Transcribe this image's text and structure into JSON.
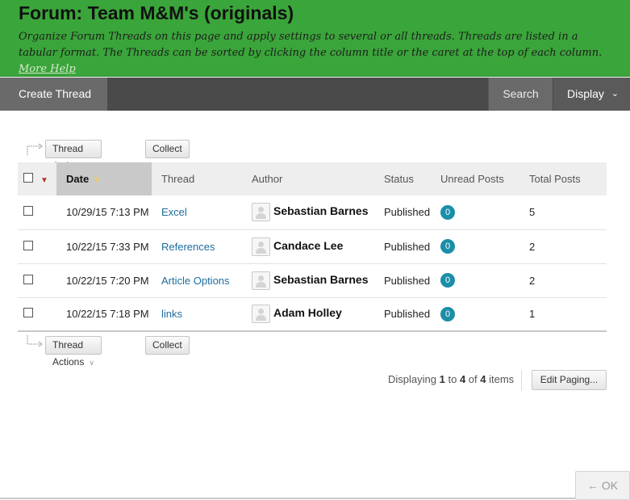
{
  "header": {
    "title": "Forum: Team M&M's (originals)",
    "description": "Organize Forum Threads on this page and apply settings to several or all threads. Threads are listed in a tabular format. The Threads can be sorted by clicking the column title or the caret at the top of each column.",
    "more_help": "More Help",
    "bg_color": "#3aa53a"
  },
  "toolbar": {
    "create_thread": "Create Thread",
    "search": "Search",
    "display": "Display"
  },
  "actions": {
    "thread_actions": "Thread Actions",
    "collect": "Collect"
  },
  "table": {
    "columns": {
      "date": "Date",
      "thread": "Thread",
      "author": "Author",
      "status": "Status",
      "unread": "Unread Posts",
      "total": "Total Posts"
    },
    "rows": [
      {
        "date": "10/29/15 7:13 PM",
        "thread": "Excel",
        "author": "Sebastian Barnes",
        "status": "Published",
        "unread": "0",
        "total": "5"
      },
      {
        "date": "10/22/15 7:33 PM",
        "thread": "References",
        "author": "Candace Lee",
        "status": "Published",
        "unread": "0",
        "total": "2"
      },
      {
        "date": "10/22/15 7:20 PM",
        "thread": "Article Options",
        "author": "Sebastian Barnes",
        "status": "Published",
        "unread": "0",
        "total": "2"
      },
      {
        "date": "10/22/15 7:18 PM",
        "thread": "links",
        "author": "Adam Holley",
        "status": "Published",
        "unread": "0",
        "total": "1"
      }
    ]
  },
  "paging": {
    "prefix": "Displaying",
    "from": "1",
    "to_word": "to",
    "to": "4",
    "of_word": "of",
    "total": "4",
    "suffix": "items",
    "edit_paging": "Edit Paging..."
  },
  "footer": {
    "ok": "OK"
  }
}
